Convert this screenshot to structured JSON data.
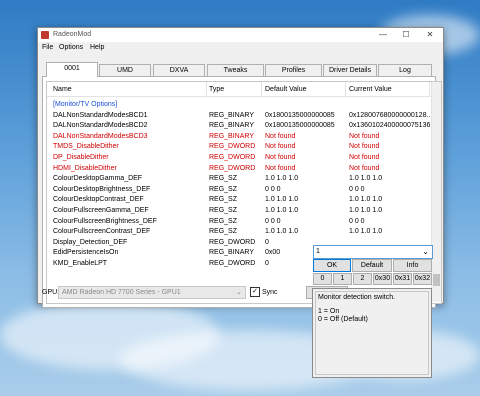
{
  "window": {
    "title": "RadeonMod"
  },
  "titlebar": {
    "minimize": "—",
    "maximize": "☐",
    "close": "✕"
  },
  "menu": [
    "File",
    "Options",
    "Help"
  ],
  "tabs": [
    "0001",
    "UMD",
    "DXVA",
    "Tweaks",
    "Profiles",
    "Driver Details",
    "Log"
  ],
  "columns": [
    "Name",
    "Type",
    "Default Value",
    "Current Value"
  ],
  "rows": [
    {
      "name": "[Monitor/TV Options]",
      "type": "",
      "default": "",
      "current": "",
      "style": "blue"
    },
    {
      "name": "DALNonStandardModesBCD1",
      "type": "REG_BINARY",
      "default": "0x1800135000000085",
      "current": "0x128007680000000128...",
      "style": ""
    },
    {
      "name": "DALNonStandardModesBCD2",
      "type": "REG_BINARY",
      "default": "0x1800135000000085",
      "current": "0x1360102400000075136...",
      "style": ""
    },
    {
      "name": "DALNonStandardModesBCD3",
      "type": "REG_BINARY",
      "default": "Not found",
      "current": "Not found",
      "style": "red"
    },
    {
      "name": "TMDS_DisableDither",
      "type": "REG_DWORD",
      "default": "Not found",
      "current": "Not found",
      "style": "red"
    },
    {
      "name": "DP_DisableDither",
      "type": "REG_DWORD",
      "default": "Not found",
      "current": "Not found",
      "style": "red"
    },
    {
      "name": "HDMI_DisableDither",
      "type": "REG_DWORD",
      "default": "Not found",
      "current": "Not found",
      "style": "red"
    },
    {
      "name": "ColourDesktopGamma_DEF",
      "type": "REG_SZ",
      "default": "1.0 1.0 1.0",
      "current": "1.0 1.0 1.0",
      "style": ""
    },
    {
      "name": "ColourDesktopBrightness_DEF",
      "type": "REG_SZ",
      "default": "0 0 0",
      "current": "0 0 0",
      "style": ""
    },
    {
      "name": "ColourDesktopContrast_DEF",
      "type": "REG_SZ",
      "default": "1.0 1.0 1.0",
      "current": "1.0 1.0 1.0",
      "style": ""
    },
    {
      "name": "ColourFullscreenGamma_DEF",
      "type": "REG_SZ",
      "default": "1.0 1.0 1.0",
      "current": "1.0 1.0 1.0",
      "style": ""
    },
    {
      "name": "ColourFullscreenBrightness_DEF",
      "type": "REG_SZ",
      "default": "0 0 0",
      "current": "0 0 0",
      "style": ""
    },
    {
      "name": "ColourFullscreenContrast_DEF",
      "type": "REG_SZ",
      "default": "1.0 1.0 1.0",
      "current": "1.0 1.0 1.0",
      "style": ""
    },
    {
      "name": "Display_Detection_DEF",
      "type": "REG_DWORD",
      "default": "0",
      "current": "",
      "style": ""
    },
    {
      "name": "EdidPersistenceIsOn",
      "type": "REG_BINARY",
      "default": "0x00",
      "current": "",
      "style": ""
    },
    {
      "name": "KMD_EnableLPT",
      "type": "REG_DWORD",
      "default": "0",
      "current": "",
      "style": ""
    }
  ],
  "editor": {
    "value": "1",
    "dropdown_arrow": "⌄",
    "buttons_top": [
      "OK",
      "Default",
      "Info"
    ],
    "buttons_bottom": [
      "0",
      "1",
      "2",
      "0x30",
      "0x31",
      "0x32"
    ]
  },
  "footer": {
    "gpu_label": "GPU:",
    "gpu_value": "AMD Radeon HD 7700 Series - GPU1",
    "sync_label": "Sync"
  },
  "help": {
    "line1": "Monitor detection switch.",
    "line2": "1 = On",
    "line3": "0 = Off (Default)"
  }
}
